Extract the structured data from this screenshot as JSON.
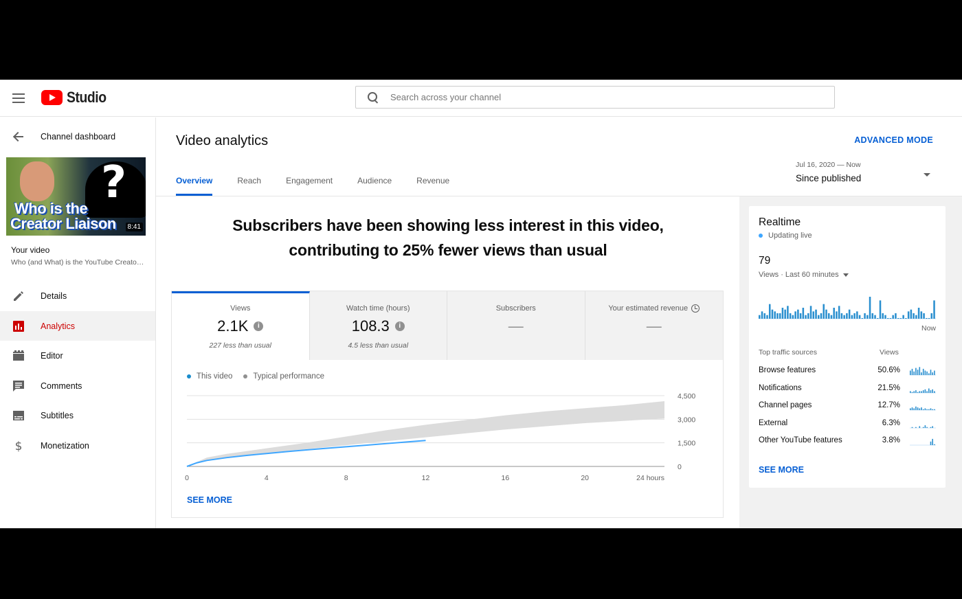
{
  "header": {
    "app_name": "Studio",
    "search_placeholder": "Search across your channel"
  },
  "sidebar": {
    "back_label": "Channel dashboard",
    "thumbnail": {
      "line1": "Who is the",
      "line2": "Creator Liaison",
      "duration": "8:41"
    },
    "your_video_label": "Your video",
    "video_title": "Who (and What) is the YouTube Creator Liaison?",
    "items": [
      {
        "label": "Details",
        "icon": "pencil-icon"
      },
      {
        "label": "Analytics",
        "icon": "analytics-icon"
      },
      {
        "label": "Editor",
        "icon": "film-icon"
      },
      {
        "label": "Comments",
        "icon": "comment-icon"
      },
      {
        "label": "Subtitles",
        "icon": "subtitles-icon"
      },
      {
        "label": "Monetization",
        "icon": "dollar-icon"
      }
    ],
    "active_item": "Analytics"
  },
  "main": {
    "title": "Video analytics",
    "advanced_mode": "ADVANCED MODE",
    "tabs": [
      "Overview",
      "Reach",
      "Engagement",
      "Audience",
      "Revenue"
    ],
    "active_tab": "Overview",
    "date_range": {
      "range": "Jul 16, 2020 — Now",
      "label": "Since published"
    },
    "headline_line1": "Subscribers have been showing less interest in this video,",
    "headline_line2": "contributing to 25% fewer views than usual",
    "metrics": [
      {
        "label": "Views",
        "value": "2.1K",
        "sub": "227 less than usual"
      },
      {
        "label": "Watch time (hours)",
        "value": "108.3",
        "sub": "4.5 less than usual"
      },
      {
        "label": "Subscribers",
        "value": "—",
        "sub": ""
      },
      {
        "label": "Your estimated revenue",
        "value": "—",
        "sub": ""
      }
    ],
    "legend": {
      "this_video": "This video",
      "typical": "Typical performance"
    },
    "see_more": "SEE MORE"
  },
  "chart_data": {
    "type": "line",
    "x_ticks": [
      "0",
      "4",
      "8",
      "12",
      "16",
      "20",
      "24 hours"
    ],
    "y_ticks": [
      "4,500",
      "3,000",
      "1,500",
      "0"
    ],
    "ylim": [
      0,
      4500
    ],
    "xlim": [
      0,
      24
    ],
    "series": [
      {
        "name": "This video",
        "color": "#3ea6ff",
        "x": [
          0,
          0.5,
          1,
          2,
          3,
          4,
          5,
          6,
          7,
          8,
          9,
          10,
          11,
          12
        ],
        "y": [
          0,
          230,
          380,
          560,
          700,
          820,
          940,
          1050,
          1150,
          1250,
          1350,
          1450,
          1550,
          1650
        ]
      }
    ],
    "typical_band": {
      "name": "Typical performance",
      "x": [
        0,
        1,
        2,
        4,
        6,
        8,
        10,
        12,
        14,
        16,
        18,
        20,
        22,
        24
      ],
      "low": [
        0,
        370,
        560,
        850,
        1100,
        1350,
        1600,
        1850,
        2100,
        2350,
        2550,
        2750,
        2900,
        3050
      ],
      "high": [
        0,
        560,
        800,
        1150,
        1500,
        1900,
        2300,
        2650,
        2950,
        3250,
        3500,
        3700,
        3900,
        4150
      ]
    }
  },
  "realtime": {
    "title": "Realtime",
    "live_label": "Updating live",
    "count": "79",
    "period": "Views · Last 60 minutes",
    "now_label": "Now",
    "bars": [
      2,
      4,
      3,
      2,
      8,
      5,
      4,
      3,
      3,
      6,
      5,
      7,
      3,
      2,
      4,
      5,
      3,
      6,
      2,
      3,
      7,
      4,
      5,
      2,
      3,
      8,
      5,
      3,
      2,
      6,
      4,
      7,
      3,
      2,
      3,
      5,
      2,
      3,
      4,
      2,
      0,
      3,
      2,
      12,
      3,
      2,
      0,
      10,
      3,
      2,
      0,
      0,
      2,
      3,
      0,
      0,
      2,
      0,
      4,
      5,
      3,
      2,
      6,
      4,
      3,
      0,
      0,
      3,
      10
    ],
    "top_sources_label": "Top traffic sources",
    "views_label": "Views",
    "sources": [
      {
        "name": "Browse features",
        "pct": "50.6%"
      },
      {
        "name": "Notifications",
        "pct": "21.5%"
      },
      {
        "name": "Channel pages",
        "pct": "12.7%"
      },
      {
        "name": "External",
        "pct": "6.3%"
      },
      {
        "name": "Other YouTube features",
        "pct": "3.8%"
      }
    ],
    "see_more": "SEE MORE"
  },
  "colors": {
    "accent": "#065fd4",
    "brand_red": "#ff0000",
    "active_nav": "#cc0000",
    "series": "#3ea6ff"
  }
}
